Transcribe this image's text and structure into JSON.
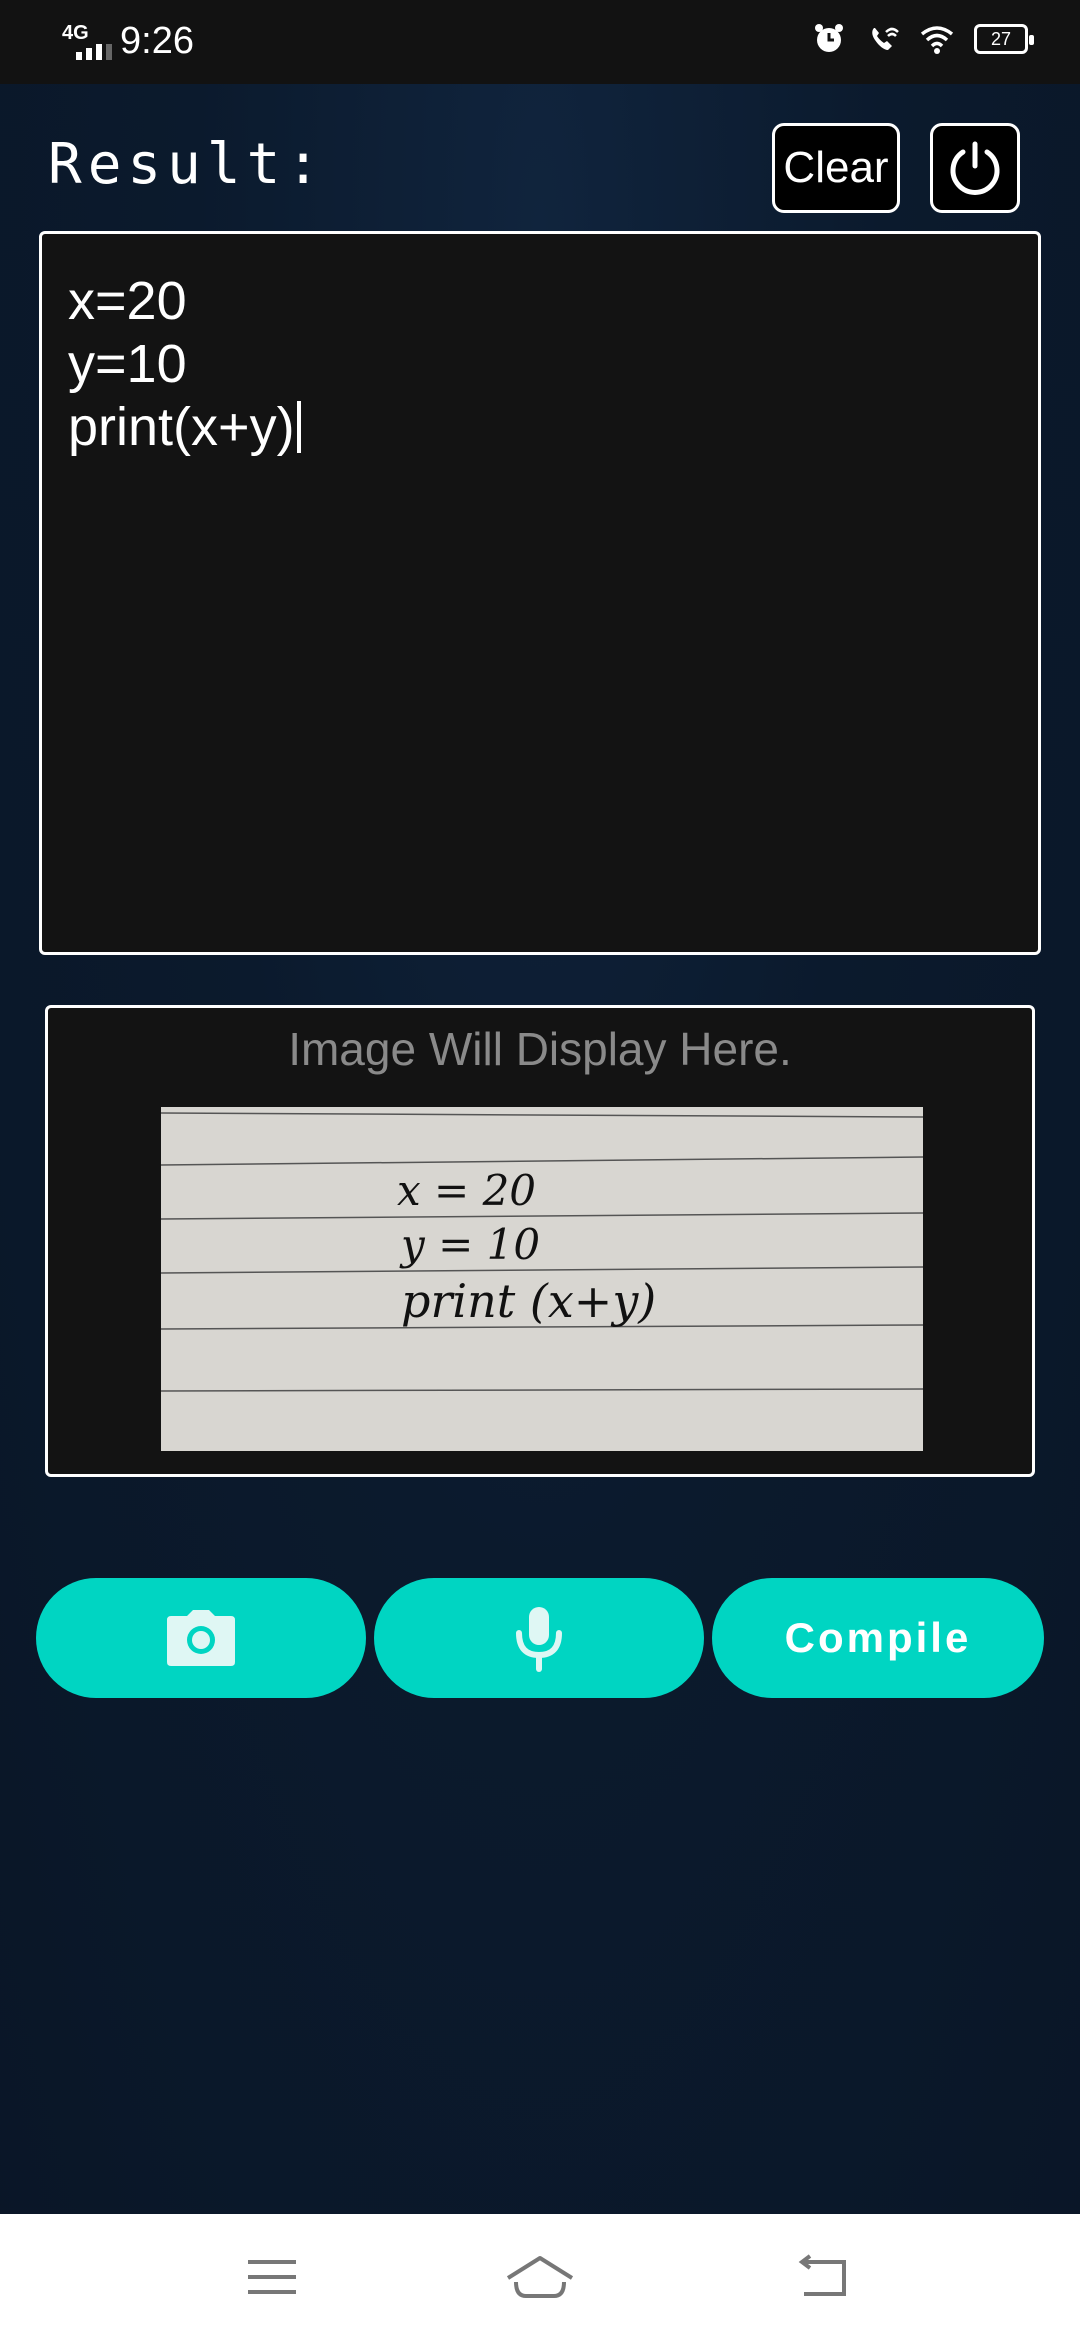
{
  "status_bar": {
    "network": "4G",
    "time": "9:26",
    "battery": "27",
    "icons": [
      "alarm-icon",
      "wifi-calling-icon",
      "wifi-icon",
      "battery-icon"
    ]
  },
  "header": {
    "title": "Result:",
    "clear_label": "Clear",
    "power_icon": "power-icon"
  },
  "editor": {
    "lines": [
      "x=20",
      "y=10",
      "print(x+y)"
    ]
  },
  "image_panel": {
    "placeholder": "Image Will Display Here.",
    "image_text": [
      "x = 20",
      "y = 10",
      "print (x+y)"
    ]
  },
  "actions": {
    "camera_icon": "camera-icon",
    "mic_icon": "microphone-icon",
    "compile_label": "Compile",
    "accent_color": "#00d5c2"
  },
  "nav": {
    "icons": [
      "menu-icon",
      "home-icon",
      "back-icon"
    ]
  }
}
